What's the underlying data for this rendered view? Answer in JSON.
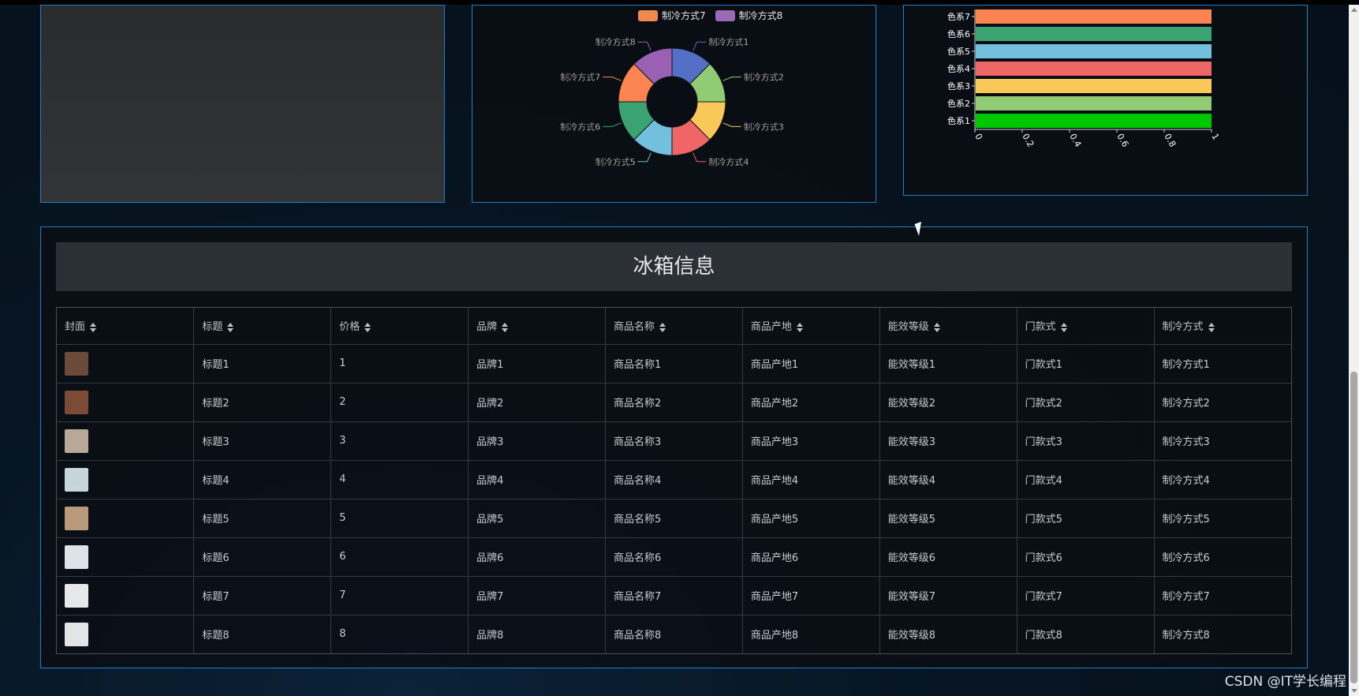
{
  "pie_legend": [
    {
      "label": "制冷方式7",
      "color": "#f2894e"
    },
    {
      "label": "制冷方式8",
      "color": "#9a6ab5"
    }
  ],
  "pie_chart": {
    "type": "pie",
    "categories": [
      "制冷方式1",
      "制冷方式2",
      "制冷方式3",
      "制冷方式4",
      "制冷方式5",
      "制冷方式6",
      "制冷方式7",
      "制冷方式8"
    ],
    "values": [
      1,
      1,
      1,
      1,
      1,
      1,
      1,
      1
    ],
    "colors": [
      "#5470c6",
      "#91cc75",
      "#fac858",
      "#ee6666",
      "#73c0de",
      "#3ba272",
      "#fc8452",
      "#9a60b4"
    ]
  },
  "bar_chart": {
    "type": "bar",
    "categories": [
      "色系1",
      "色系2",
      "色系3",
      "色系4",
      "色系5",
      "色系6",
      "色系7"
    ],
    "values": [
      1,
      1,
      1,
      1,
      1,
      1,
      1
    ],
    "colors": [
      "#00c800",
      "#91cc75",
      "#fac858",
      "#ee6666",
      "#73c0de",
      "#3ba272",
      "#fc8452"
    ],
    "xticks": [
      "0",
      "0.2",
      "0.4",
      "0.6",
      "0.8",
      "1"
    ],
    "xlim": [
      0,
      1
    ]
  },
  "table": {
    "title": "冰箱信息",
    "columns": [
      "封面",
      "标题",
      "价格",
      "品牌",
      "商品名称",
      "商品产地",
      "能效等级",
      "门款式",
      "制冷方式"
    ],
    "rows": [
      {
        "thumb": "#6b4a3a",
        "cells": [
          "标题1",
          "1",
          "品牌1",
          "商品名称1",
          "商品产地1",
          "能效等级1",
          "门款式1",
          "制冷方式1"
        ]
      },
      {
        "thumb": "#7a4b35",
        "cells": [
          "标题2",
          "2",
          "品牌2",
          "商品名称2",
          "商品产地2",
          "能效等级2",
          "门款式2",
          "制冷方式2"
        ]
      },
      {
        "thumb": "#b8a898",
        "cells": [
          "标题3",
          "3",
          "品牌3",
          "商品名称3",
          "商品产地3",
          "能效等级3",
          "门款式3",
          "制冷方式3"
        ]
      },
      {
        "thumb": "#c8d4dc",
        "cells": [
          "标题4",
          "4",
          "品牌4",
          "商品名称4",
          "商品产地4",
          "能效等级4",
          "门款式4",
          "制冷方式4"
        ]
      },
      {
        "thumb": "#b89a7a",
        "cells": [
          "标题5",
          "5",
          "品牌5",
          "商品名称5",
          "商品产地5",
          "能效等级5",
          "门款式5",
          "制冷方式5"
        ]
      },
      {
        "thumb": "#dce4ea",
        "cells": [
          "标题6",
          "6",
          "品牌6",
          "商品名称6",
          "商品产地6",
          "能效等级6",
          "门款式6",
          "制冷方式6"
        ]
      },
      {
        "thumb": "#e6e8ea",
        "cells": [
          "标题7",
          "7",
          "品牌7",
          "商品名称7",
          "商品产地7",
          "能效等级7",
          "门款式7",
          "制冷方式7"
        ]
      },
      {
        "thumb": "#e2e4e6",
        "cells": [
          "标题8",
          "8",
          "品牌8",
          "商品名称8",
          "商品产地8",
          "能效等级8",
          "门款式8",
          "制冷方式8"
        ]
      }
    ]
  },
  "watermark": "CSDN @IT学长编程"
}
